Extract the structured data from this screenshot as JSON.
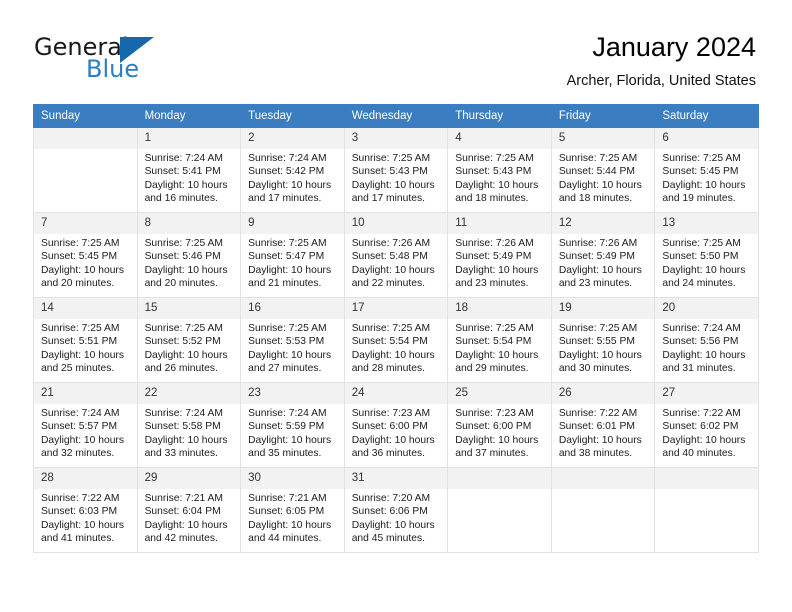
{
  "brand": {
    "name_top": "General",
    "name_bottom": "Blue",
    "triangle_color": "#1668ac",
    "blue_text_color": "#2980c4"
  },
  "header": {
    "title": "January 2024",
    "subtitle": "Archer, Florida, United States",
    "header_bg_color": "#3a7dc0",
    "daynum_bg_color": "#f2f2f2"
  },
  "weekdays": [
    "Sunday",
    "Monday",
    "Tuesday",
    "Wednesday",
    "Thursday",
    "Friday",
    "Saturday"
  ],
  "weeks": [
    [
      {
        "day": "",
        "sunrise": "",
        "sunset": "",
        "daylight1": "",
        "daylight2": ""
      },
      {
        "day": "1",
        "sunrise": "Sunrise: 7:24 AM",
        "sunset": "Sunset: 5:41 PM",
        "daylight1": "Daylight: 10 hours",
        "daylight2": "and 16 minutes."
      },
      {
        "day": "2",
        "sunrise": "Sunrise: 7:24 AM",
        "sunset": "Sunset: 5:42 PM",
        "daylight1": "Daylight: 10 hours",
        "daylight2": "and 17 minutes."
      },
      {
        "day": "3",
        "sunrise": "Sunrise: 7:25 AM",
        "sunset": "Sunset: 5:43 PM",
        "daylight1": "Daylight: 10 hours",
        "daylight2": "and 17 minutes."
      },
      {
        "day": "4",
        "sunrise": "Sunrise: 7:25 AM",
        "sunset": "Sunset: 5:43 PM",
        "daylight1": "Daylight: 10 hours",
        "daylight2": "and 18 minutes."
      },
      {
        "day": "5",
        "sunrise": "Sunrise: 7:25 AM",
        "sunset": "Sunset: 5:44 PM",
        "daylight1": "Daylight: 10 hours",
        "daylight2": "and 18 minutes."
      },
      {
        "day": "6",
        "sunrise": "Sunrise: 7:25 AM",
        "sunset": "Sunset: 5:45 PM",
        "daylight1": "Daylight: 10 hours",
        "daylight2": "and 19 minutes."
      }
    ],
    [
      {
        "day": "7",
        "sunrise": "Sunrise: 7:25 AM",
        "sunset": "Sunset: 5:45 PM",
        "daylight1": "Daylight: 10 hours",
        "daylight2": "and 20 minutes."
      },
      {
        "day": "8",
        "sunrise": "Sunrise: 7:25 AM",
        "sunset": "Sunset: 5:46 PM",
        "daylight1": "Daylight: 10 hours",
        "daylight2": "and 20 minutes."
      },
      {
        "day": "9",
        "sunrise": "Sunrise: 7:25 AM",
        "sunset": "Sunset: 5:47 PM",
        "daylight1": "Daylight: 10 hours",
        "daylight2": "and 21 minutes."
      },
      {
        "day": "10",
        "sunrise": "Sunrise: 7:26 AM",
        "sunset": "Sunset: 5:48 PM",
        "daylight1": "Daylight: 10 hours",
        "daylight2": "and 22 minutes."
      },
      {
        "day": "11",
        "sunrise": "Sunrise: 7:26 AM",
        "sunset": "Sunset: 5:49 PM",
        "daylight1": "Daylight: 10 hours",
        "daylight2": "and 23 minutes."
      },
      {
        "day": "12",
        "sunrise": "Sunrise: 7:26 AM",
        "sunset": "Sunset: 5:49 PM",
        "daylight1": "Daylight: 10 hours",
        "daylight2": "and 23 minutes."
      },
      {
        "day": "13",
        "sunrise": "Sunrise: 7:25 AM",
        "sunset": "Sunset: 5:50 PM",
        "daylight1": "Daylight: 10 hours",
        "daylight2": "and 24 minutes."
      }
    ],
    [
      {
        "day": "14",
        "sunrise": "Sunrise: 7:25 AM",
        "sunset": "Sunset: 5:51 PM",
        "daylight1": "Daylight: 10 hours",
        "daylight2": "and 25 minutes."
      },
      {
        "day": "15",
        "sunrise": "Sunrise: 7:25 AM",
        "sunset": "Sunset: 5:52 PM",
        "daylight1": "Daylight: 10 hours",
        "daylight2": "and 26 minutes."
      },
      {
        "day": "16",
        "sunrise": "Sunrise: 7:25 AM",
        "sunset": "Sunset: 5:53 PM",
        "daylight1": "Daylight: 10 hours",
        "daylight2": "and 27 minutes."
      },
      {
        "day": "17",
        "sunrise": "Sunrise: 7:25 AM",
        "sunset": "Sunset: 5:54 PM",
        "daylight1": "Daylight: 10 hours",
        "daylight2": "and 28 minutes."
      },
      {
        "day": "18",
        "sunrise": "Sunrise: 7:25 AM",
        "sunset": "Sunset: 5:54 PM",
        "daylight1": "Daylight: 10 hours",
        "daylight2": "and 29 minutes."
      },
      {
        "day": "19",
        "sunrise": "Sunrise: 7:25 AM",
        "sunset": "Sunset: 5:55 PM",
        "daylight1": "Daylight: 10 hours",
        "daylight2": "and 30 minutes."
      },
      {
        "day": "20",
        "sunrise": "Sunrise: 7:24 AM",
        "sunset": "Sunset: 5:56 PM",
        "daylight1": "Daylight: 10 hours",
        "daylight2": "and 31 minutes."
      }
    ],
    [
      {
        "day": "21",
        "sunrise": "Sunrise: 7:24 AM",
        "sunset": "Sunset: 5:57 PM",
        "daylight1": "Daylight: 10 hours",
        "daylight2": "and 32 minutes."
      },
      {
        "day": "22",
        "sunrise": "Sunrise: 7:24 AM",
        "sunset": "Sunset: 5:58 PM",
        "daylight1": "Daylight: 10 hours",
        "daylight2": "and 33 minutes."
      },
      {
        "day": "23",
        "sunrise": "Sunrise: 7:24 AM",
        "sunset": "Sunset: 5:59 PM",
        "daylight1": "Daylight: 10 hours",
        "daylight2": "and 35 minutes."
      },
      {
        "day": "24",
        "sunrise": "Sunrise: 7:23 AM",
        "sunset": "Sunset: 6:00 PM",
        "daylight1": "Daylight: 10 hours",
        "daylight2": "and 36 minutes."
      },
      {
        "day": "25",
        "sunrise": "Sunrise: 7:23 AM",
        "sunset": "Sunset: 6:00 PM",
        "daylight1": "Daylight: 10 hours",
        "daylight2": "and 37 minutes."
      },
      {
        "day": "26",
        "sunrise": "Sunrise: 7:22 AM",
        "sunset": "Sunset: 6:01 PM",
        "daylight1": "Daylight: 10 hours",
        "daylight2": "and 38 minutes."
      },
      {
        "day": "27",
        "sunrise": "Sunrise: 7:22 AM",
        "sunset": "Sunset: 6:02 PM",
        "daylight1": "Daylight: 10 hours",
        "daylight2": "and 40 minutes."
      }
    ],
    [
      {
        "day": "28",
        "sunrise": "Sunrise: 7:22 AM",
        "sunset": "Sunset: 6:03 PM",
        "daylight1": "Daylight: 10 hours",
        "daylight2": "and 41 minutes."
      },
      {
        "day": "29",
        "sunrise": "Sunrise: 7:21 AM",
        "sunset": "Sunset: 6:04 PM",
        "daylight1": "Daylight: 10 hours",
        "daylight2": "and 42 minutes."
      },
      {
        "day": "30",
        "sunrise": "Sunrise: 7:21 AM",
        "sunset": "Sunset: 6:05 PM",
        "daylight1": "Daylight: 10 hours",
        "daylight2": "and 44 minutes."
      },
      {
        "day": "31",
        "sunrise": "Sunrise: 7:20 AM",
        "sunset": "Sunset: 6:06 PM",
        "daylight1": "Daylight: 10 hours",
        "daylight2": "and 45 minutes."
      },
      {
        "day": "",
        "sunrise": "",
        "sunset": "",
        "daylight1": "",
        "daylight2": ""
      },
      {
        "day": "",
        "sunrise": "",
        "sunset": "",
        "daylight1": "",
        "daylight2": ""
      },
      {
        "day": "",
        "sunrise": "",
        "sunset": "",
        "daylight1": "",
        "daylight2": ""
      }
    ]
  ]
}
